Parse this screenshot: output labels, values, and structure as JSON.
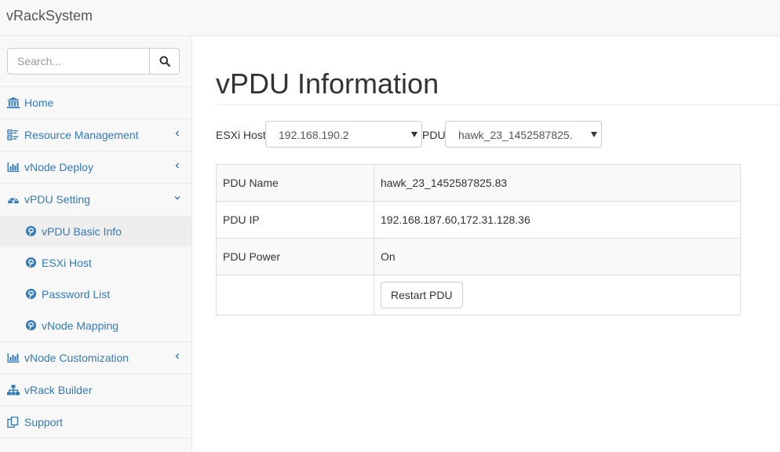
{
  "app": {
    "brand": "vRackSystem"
  },
  "sidebar": {
    "search": {
      "placeholder": "Search...",
      "value": ""
    },
    "items": [
      {
        "label": "Home",
        "icon": "institution-icon",
        "has_chevron": false
      },
      {
        "label": "Resource Management",
        "icon": "resource-icon",
        "has_chevron": true,
        "chevron": "left"
      },
      {
        "label": "vNode Deploy",
        "icon": "bar-chart-icon",
        "has_chevron": true,
        "chevron": "left"
      },
      {
        "label": "vPDU Setting",
        "icon": "dashboard-icon",
        "has_chevron": true,
        "chevron": "down",
        "expanded": true,
        "children": [
          {
            "label": "vPDU Basic Info",
            "icon": "pinterest-icon",
            "active": true
          },
          {
            "label": "ESXi Host",
            "icon": "pinterest-icon"
          },
          {
            "label": "Password List",
            "icon": "pinterest-icon"
          },
          {
            "label": "vNode Mapping",
            "icon": "pinterest-icon"
          }
        ]
      },
      {
        "label": "vNode Customization",
        "icon": "bar-chart-icon",
        "has_chevron": true,
        "chevron": "left"
      },
      {
        "label": "vRack Builder",
        "icon": "sitemap-icon",
        "has_chevron": false
      },
      {
        "label": "Support",
        "icon": "copy-icon",
        "has_chevron": false
      }
    ]
  },
  "main": {
    "title": "vPDU Information",
    "filters": {
      "esxi_label": "ESXi Host",
      "esxi_value": "192.168.190.2",
      "pdu_label": "PDU",
      "pdu_value": "hawk_23_1452587825."
    },
    "table": {
      "rows": [
        {
          "key": "PDU Name",
          "value": "hawk_23_1452587825.83"
        },
        {
          "key": "PDU IP",
          "value": "192.168.187.60,172.31.128.36"
        },
        {
          "key": "PDU Power",
          "value": "On"
        }
      ],
      "restart_button": "Restart PDU"
    }
  },
  "colors": {
    "link": "#337ab7",
    "navbar_bg": "#f8f8f8",
    "border": "#e7e7e7",
    "active_bg": "#eeeeee",
    "table_stripe": "#f9f9f9"
  }
}
